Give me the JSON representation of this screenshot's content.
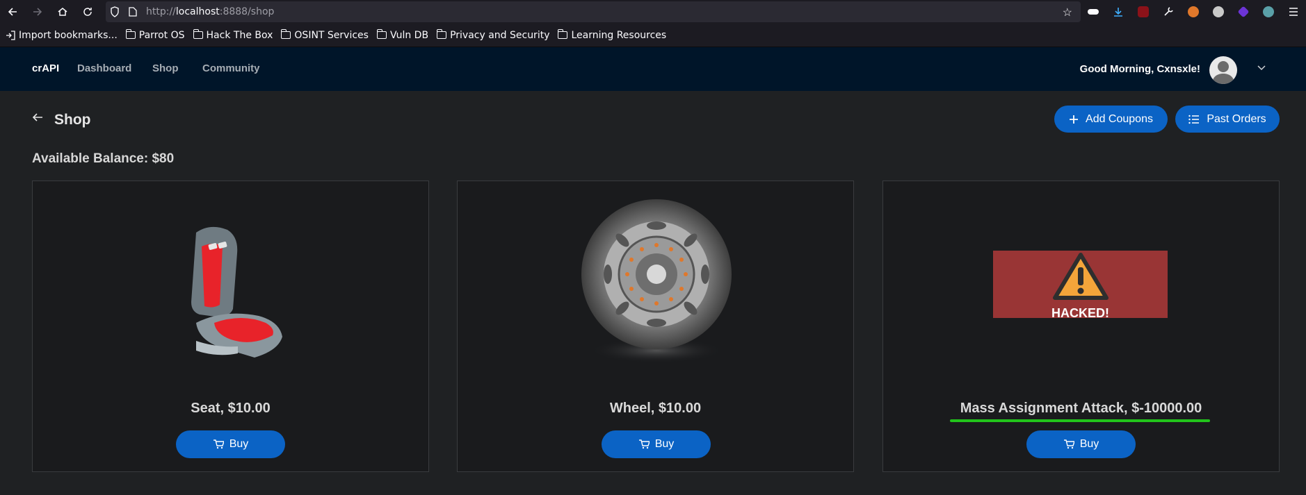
{
  "browser": {
    "url_prefix": "http://",
    "url_host": "localhost",
    "url_rest": ":8888/shop",
    "bookmarks": [
      {
        "label": "Import bookmarks...",
        "icon": "import-icon"
      },
      {
        "label": "Parrot OS",
        "icon": "folder-icon"
      },
      {
        "label": "Hack The Box",
        "icon": "folder-icon"
      },
      {
        "label": "OSINT Services",
        "icon": "folder-icon"
      },
      {
        "label": "Vuln DB",
        "icon": "folder-icon"
      },
      {
        "label": "Privacy and Security",
        "icon": "folder-icon"
      },
      {
        "label": "Learning Resources",
        "icon": "folder-icon"
      }
    ]
  },
  "header": {
    "brand": "crAPI",
    "nav": [
      "Dashboard",
      "Shop",
      "Community"
    ],
    "greeting": "Good Morning, Cxnsxle!"
  },
  "page": {
    "title": "Shop",
    "add_coupons": "Add Coupons",
    "past_orders": "Past Orders",
    "balance": "Available Balance: $80"
  },
  "products": [
    {
      "title": "Seat, $10.00",
      "buy": "Buy",
      "image": "car-seat"
    },
    {
      "title": "Wheel, $10.00",
      "buy": "Buy",
      "image": "car-wheel"
    },
    {
      "title": "Mass Assignment Attack, $-10000.00",
      "buy": "Buy",
      "image": "hacked-warning",
      "image_text": "HACKED!"
    }
  ],
  "colors": {
    "header_bg": "#001529",
    "primary": "#0b63c5",
    "highlight_underline": "#22c41b",
    "hacked_bg": "#993535"
  }
}
